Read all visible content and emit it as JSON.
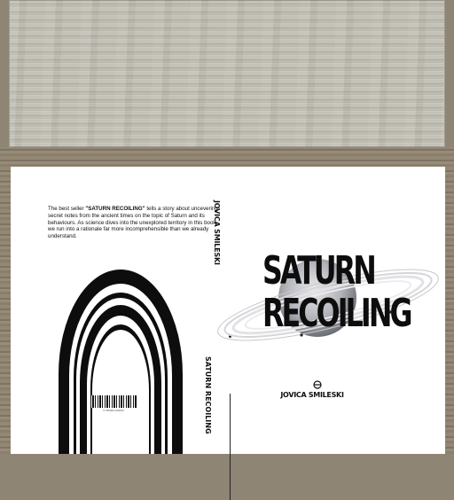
{
  "book": {
    "blurb_intro": "The best seller ",
    "blurb_title": "\"SATURN RECOILING\"",
    "blurb_rest": " tells a story about uncevering secret notes from the ancient times on the topic of Saturn and its behaviours. As science dives into the unexplored territory in this book, we run into a rationale far more incomprehensible than we already understand.",
    "spine_author": "JOVICA SMILESKI",
    "spine_title": "SATURN RECOILING",
    "title_line1": "SATURN",
    "title_line2": "RECOILING",
    "front_author": "JOVICA SMILESKI",
    "barcode_number": "9 780000 000000"
  },
  "colors": {
    "ink": "#111111",
    "cover": "#ffffff",
    "frame": "#8e8574",
    "paper": "#c9c7bd"
  }
}
